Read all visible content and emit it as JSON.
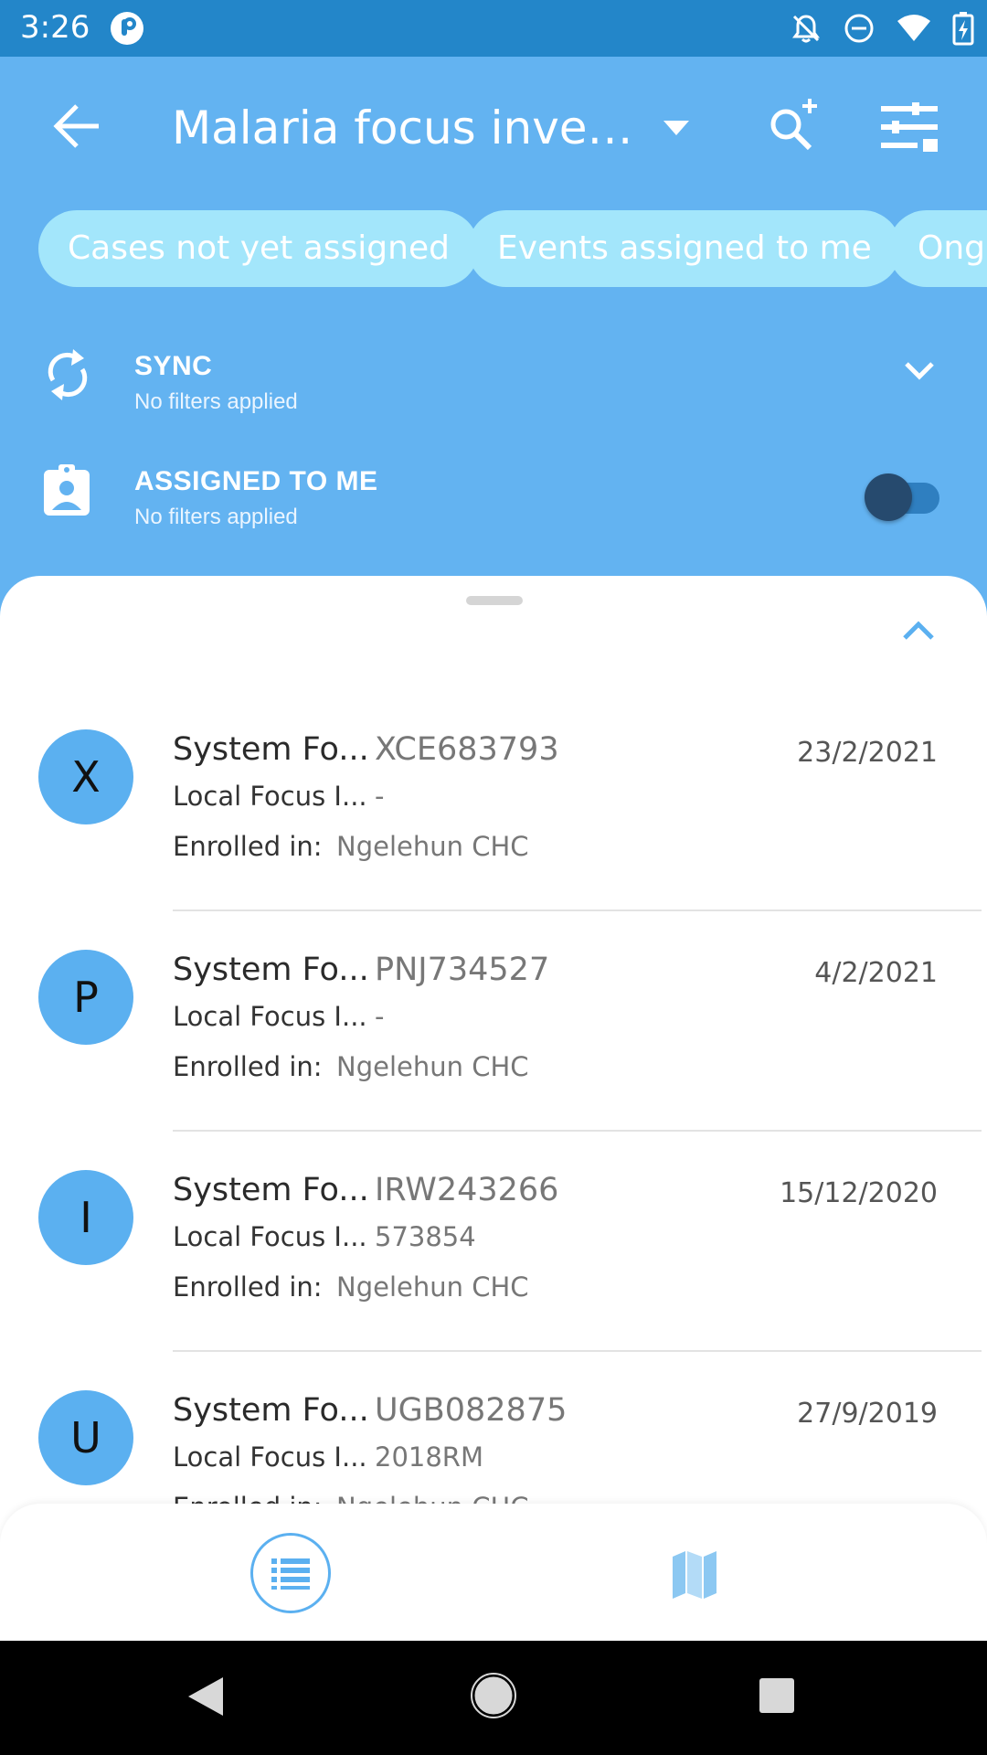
{
  "status_bar": {
    "time": "3:26",
    "icons": [
      "app-indicator-icon",
      "notifications-off-icon",
      "do-not-disturb-icon",
      "wifi-icon",
      "battery-charging-icon"
    ]
  },
  "toolbar": {
    "title": "Malaria focus investigation",
    "icons": [
      "back-arrow-icon",
      "dropdown-caret-icon",
      "search-add-icon",
      "filter-icon"
    ]
  },
  "chips": [
    {
      "label": "Cases not yet assigned"
    },
    {
      "label": "Events assigned to me"
    },
    {
      "label": "Ongoing"
    }
  ],
  "filters": {
    "sync": {
      "title": "SYNC",
      "subtitle": "No filters applied"
    },
    "assigned": {
      "title": "ASSIGNED TO ME",
      "subtitle": "No filters applied",
      "enabled": false
    }
  },
  "list": {
    "items": [
      {
        "avatar": "X",
        "attr1_label": "System Fo...",
        "attr1_value": "XCE683793",
        "date": "23/2/2021",
        "attr2_label": "Local Focus I...",
        "attr2_value": "-",
        "enrolled_label": "Enrolled in:",
        "enrolled_value": "Ngelehun CHC"
      },
      {
        "avatar": "P",
        "attr1_label": "System Fo...",
        "attr1_value": "PNJ734527",
        "date": "4/2/2021",
        "attr2_label": "Local Focus I...",
        "attr2_value": "-",
        "enrolled_label": "Enrolled in:",
        "enrolled_value": "Ngelehun CHC"
      },
      {
        "avatar": "I",
        "attr1_label": "System Fo...",
        "attr1_value": "IRW243266",
        "date": "15/12/2020",
        "attr2_label": "Local Focus I...",
        "attr2_value": "573854",
        "enrolled_label": "Enrolled in:",
        "enrolled_value": "Ngelehun CHC"
      },
      {
        "avatar": "U",
        "attr1_label": "System Fo...",
        "attr1_value": "UGB082875",
        "date": "27/9/2019",
        "attr2_label": "Local Focus I...",
        "attr2_value": "2018RM",
        "enrolled_label": "Enrolled in:",
        "enrolled_value": "Ngelehun CHC"
      }
    ]
  },
  "bottom_nav": {
    "icons": [
      "list-view-icon",
      "map-view-icon"
    ]
  },
  "system_nav": {
    "icons": [
      "back-triangle-icon",
      "home-circle-icon",
      "recents-square-icon"
    ]
  },
  "colors": {
    "primary": "#63b3f1",
    "status_bar": "#2386c9",
    "accent": "#5bb0f0",
    "chip": "#a3e6fb"
  }
}
